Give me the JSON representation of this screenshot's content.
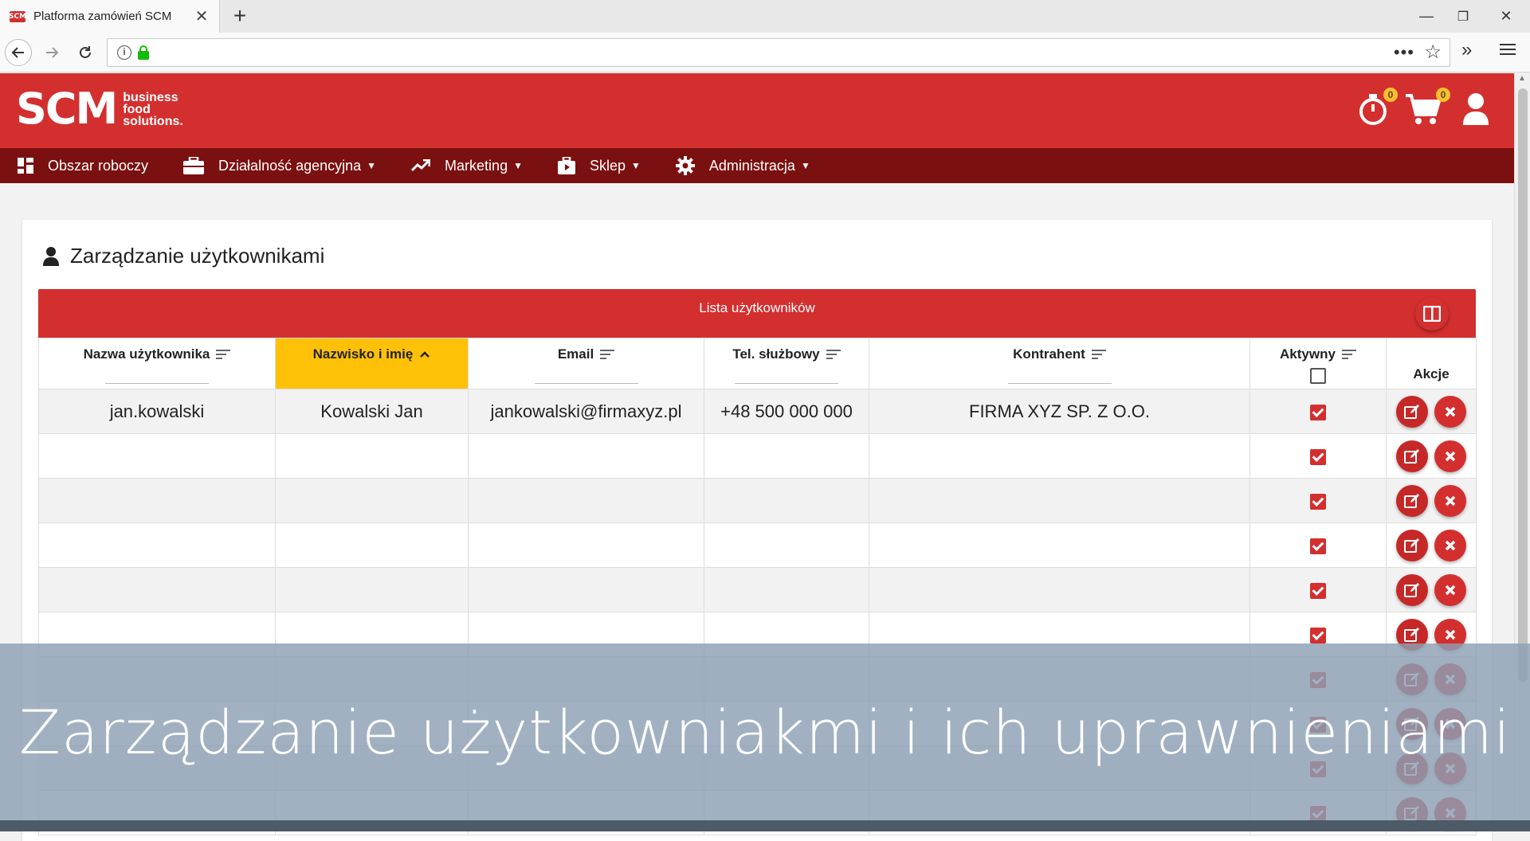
{
  "browser": {
    "tab_title": "Platforma zamówień SCM",
    "favicon_text": "SCM",
    "new_tab": "+",
    "tab_close": "✕",
    "minimize": "—",
    "maximize": "❐",
    "close": "✕",
    "url_more": "•••",
    "star": "☆",
    "overflow": "»"
  },
  "header": {
    "logo_main": "SCM",
    "logo_sub_1": "business",
    "logo_sub_2": "food",
    "logo_sub_3": "solutions.",
    "timer_badge": "0",
    "cart_badge": "0"
  },
  "menu": {
    "items": [
      {
        "label": "Obszar roboczy",
        "icon": "dashboard-icon"
      },
      {
        "label": "Działalność agencyjna",
        "icon": "briefcase-icon"
      },
      {
        "label": "Marketing",
        "icon": "trending-up-icon"
      },
      {
        "label": "Sklep",
        "icon": "shop-icon"
      },
      {
        "label": "Administracja",
        "icon": "gear-icon"
      }
    ]
  },
  "page": {
    "title": "Zarządzanie użytkownikami",
    "table_title": "Lista użytkowników"
  },
  "table": {
    "columns": [
      "Nazwa użytkownika",
      "Nazwisko i imię",
      "Email",
      "Tel. służbowy",
      "Kontrahent",
      "Aktywny",
      "Akcje"
    ],
    "rows": [
      {
        "username": "jan.kowalski",
        "name": "Kowalski Jan",
        "email": "jankowalski@firmaxyz.pl",
        "phone": "+48 500 000 000",
        "company": "FIRMA XYZ SP. Z O.O.",
        "active": true
      },
      {
        "username": "",
        "name": "",
        "email": "",
        "phone": "",
        "company": "",
        "active": true
      },
      {
        "username": "",
        "name": "",
        "email": "",
        "phone": "",
        "company": "",
        "active": true
      },
      {
        "username": "",
        "name": "",
        "email": "",
        "phone": "",
        "company": "",
        "active": true
      },
      {
        "username": "",
        "name": "",
        "email": "",
        "phone": "",
        "company": "",
        "active": true
      },
      {
        "username": "",
        "name": "",
        "email": "",
        "phone": "",
        "company": "",
        "active": true
      },
      {
        "username": "",
        "name": "",
        "email": "",
        "phone": "",
        "company": "",
        "active": true
      },
      {
        "username": "",
        "name": "",
        "email": "",
        "phone": "",
        "company": "",
        "active": true
      },
      {
        "username": "",
        "name": "",
        "email": "",
        "phone": "",
        "company": "",
        "active": true
      },
      {
        "username": "",
        "name": "",
        "email": "",
        "phone": "",
        "company": "",
        "active": true
      }
    ]
  },
  "overlay": {
    "caption": "Zarządzanie użytkowniakmi i ich uprawnieniami"
  },
  "colors": {
    "brand_red": "#d32f2f",
    "menu_dark_red": "#7b1010",
    "sort_highlight": "#ffc107",
    "badge_yellow": "#fbc02d"
  }
}
